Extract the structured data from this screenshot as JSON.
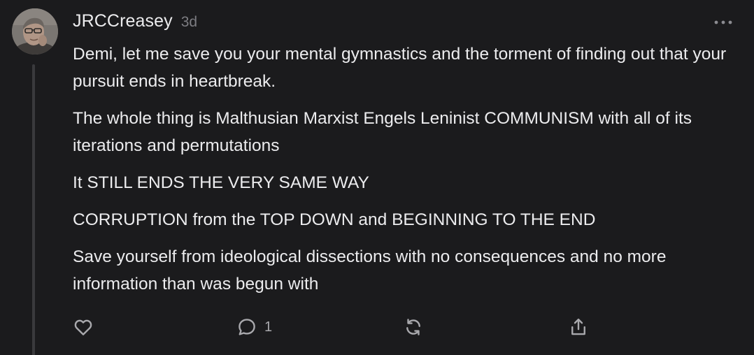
{
  "comment": {
    "author": "JRCCreasey",
    "timestamp": "3d",
    "paragraphs": [
      "Demi, let me save you your mental gymnastics and the torment of finding out that your pursuit ends in heartbreak.",
      "The whole thing is Malthusian Marxist Engels Leninist COMMUNISM with all of its iterations and permutations",
      "It STILL ENDS THE VERY SAME WAY",
      "CORRUPTION from the TOP DOWN and BEGINNING TO THE END",
      "Save yourself from ideological dissections with no consequences and no more information than was begun with"
    ],
    "more_menu_icon": "ellipsis-icon"
  },
  "actions": {
    "like_icon": "heart-icon",
    "reply_icon": "speech-bubble-icon",
    "reply_count": "1",
    "restack_icon": "refresh-icon",
    "share_icon": "share-icon"
  },
  "colors": {
    "background": "#1b1b1d",
    "text": "#ececee",
    "muted": "#7d7d82",
    "icon": "#a9a9ad",
    "thread_line": "#3a3a3d"
  }
}
